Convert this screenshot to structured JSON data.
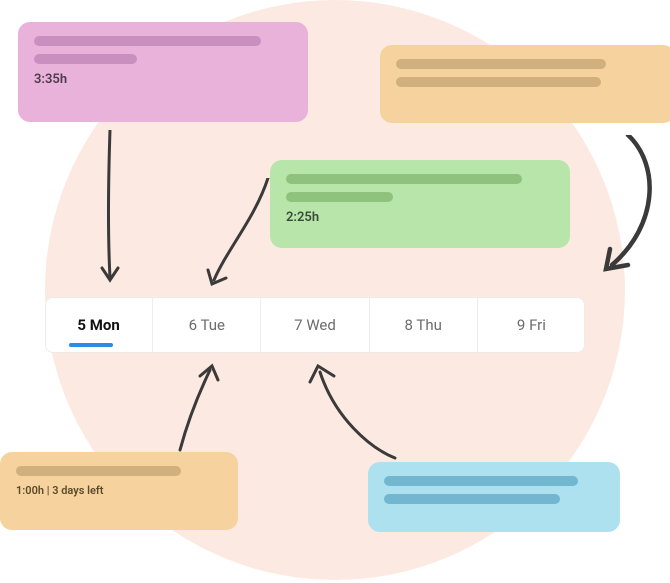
{
  "cards": {
    "pink": {
      "duration": "3:35h"
    },
    "green": {
      "duration": "2:25h"
    },
    "orange_bottom": {
      "caption": "1:00h | 3 days left"
    }
  },
  "week": [
    {
      "label": "5 Mon",
      "active": true
    },
    {
      "label": "6 Tue",
      "active": false
    },
    {
      "label": "7 Wed",
      "active": false
    },
    {
      "label": "8 Thu",
      "active": false
    },
    {
      "label": "9 Fri",
      "active": false
    }
  ]
}
